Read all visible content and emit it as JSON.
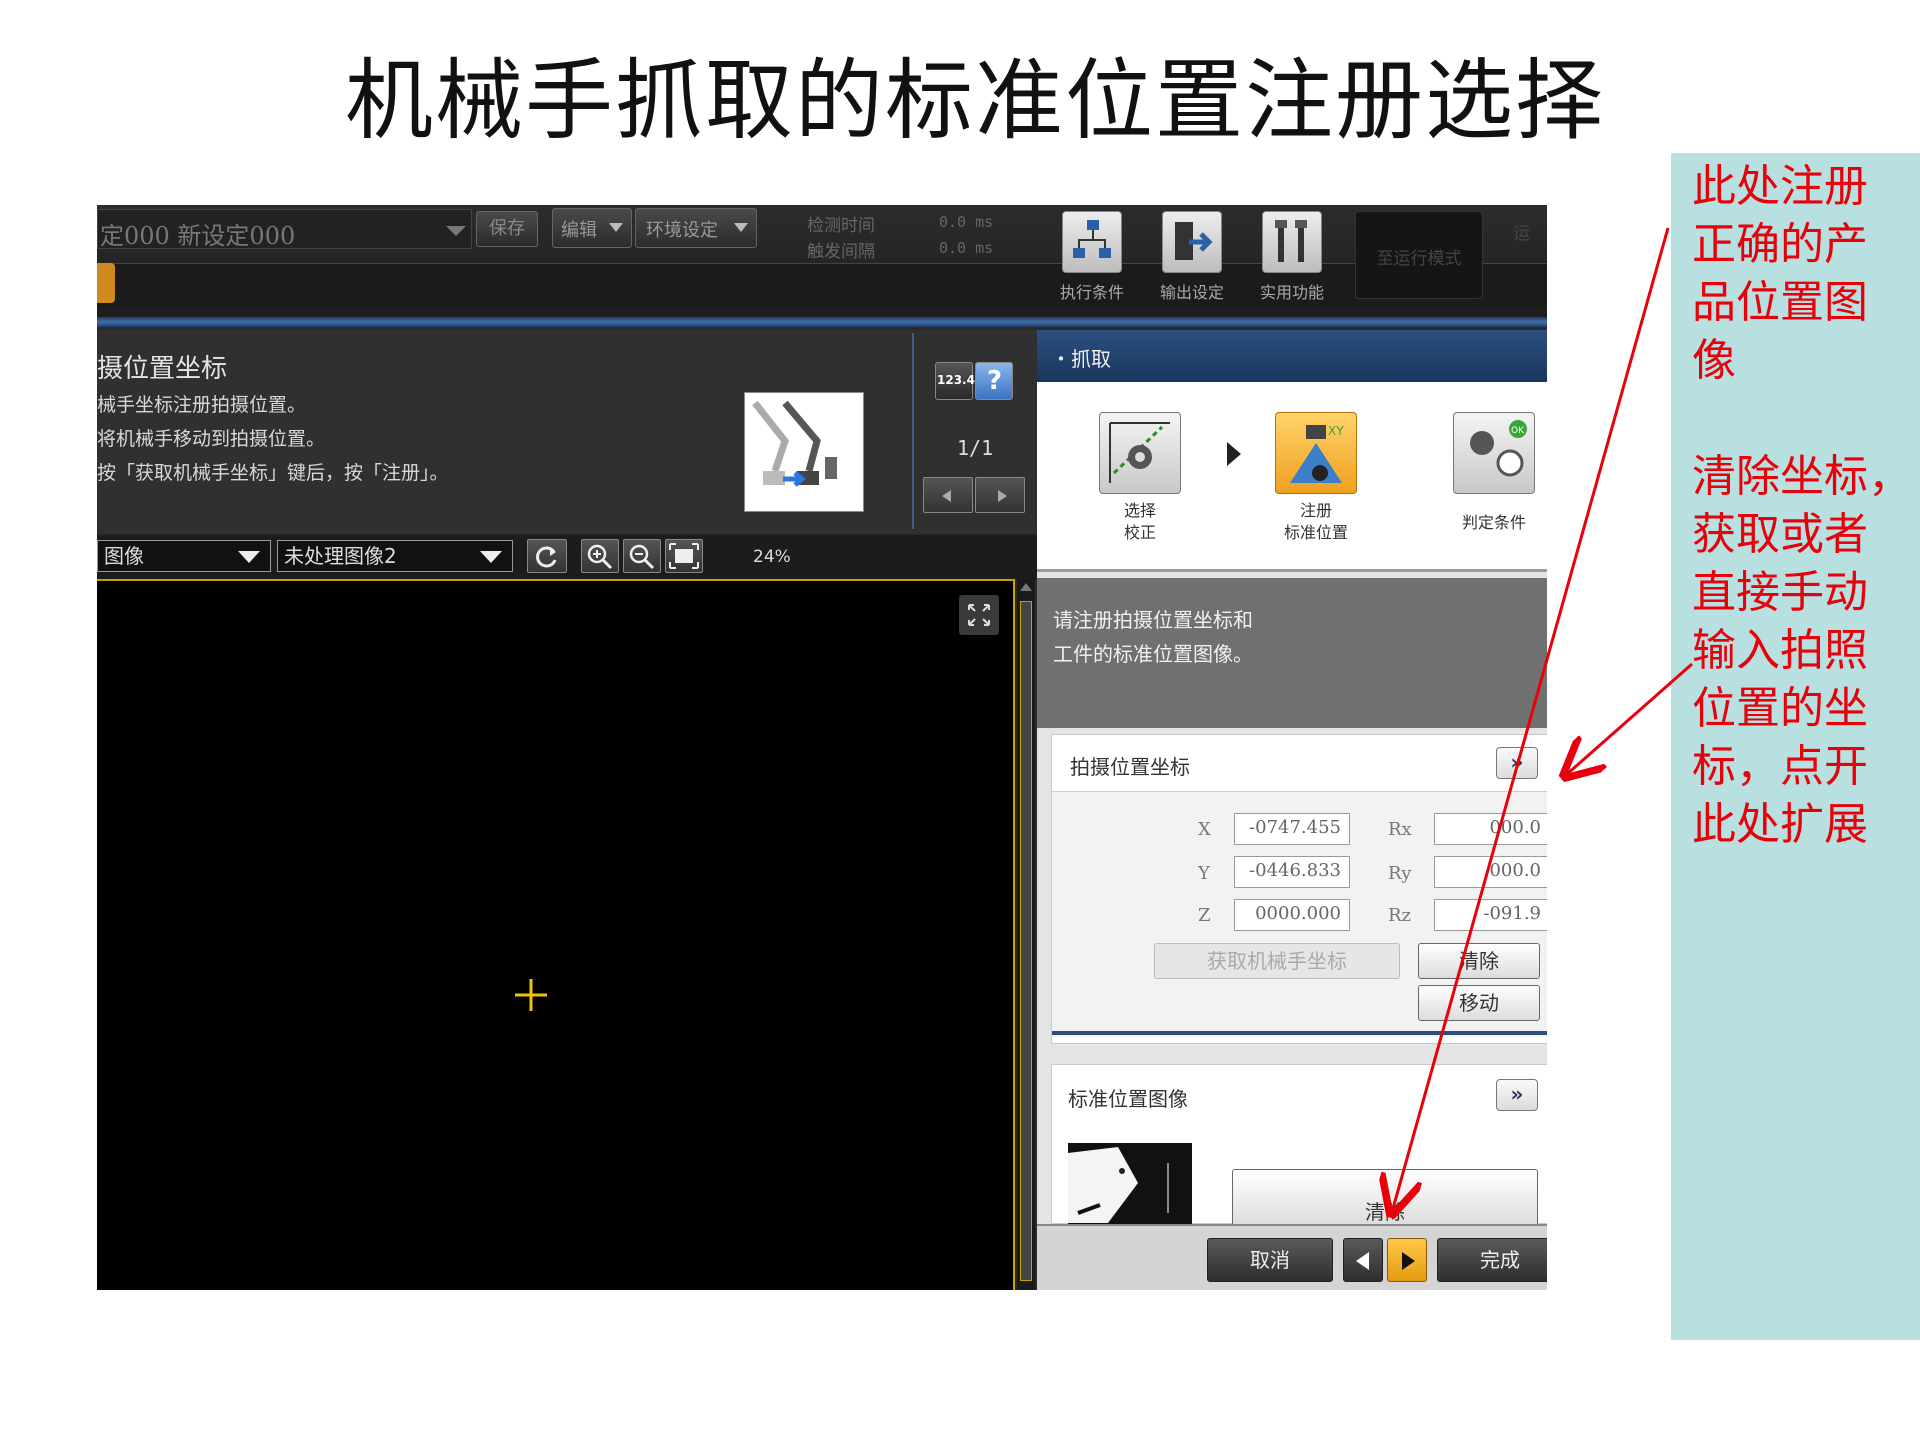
{
  "slide": {
    "title": "机械手抓取的标准位置注册选择",
    "annotation": "此处注册\n正确的产\n品位置图\n像\n\n清除坐标，\n获取或者\n直接手动\n输入拍照\n位置的坐\n标，点开\n此处扩展"
  },
  "toolbar": {
    "scene_label": "定000  新设定000",
    "save_label": "保存",
    "edit_menu": "编辑",
    "env_menu": "环境设定",
    "detect_time_label": "检测时间",
    "trigger_interval_label": "触发间隔",
    "detect_time_value": "0.0 ms",
    "trigger_interval_value": "0.0 ms",
    "exec_cond_label": "执行条件",
    "output_label": "输出设定",
    "utility_label": "实用功能",
    "run_mode_label": "至运行模式",
    "cut_label": "运"
  },
  "guide": {
    "title": "摄位置坐标",
    "line1": "械手坐标注册拍摄位置。",
    "line2": "将机械手移动到拍摄位置。",
    "line3": "按「获取机械手坐标」键后，按「注册」。",
    "num_btn": "123.4",
    "help_btn": "?",
    "page": "1/1"
  },
  "image_toolbar": {
    "image_select": "图像",
    "source_select": "未处理图像2",
    "zoom_level": "24%"
  },
  "right_panel": {
    "header": "・抓取",
    "steps": [
      {
        "label": "选择\n校正"
      },
      {
        "label": "注册\n标准位置"
      },
      {
        "label": "判定条件"
      }
    ],
    "instruction_line1": "请注册拍摄位置坐标和",
    "instruction_line2": "工件的标准位置图像。",
    "coord_section": {
      "title": "拍摄位置坐标",
      "expand": "»",
      "x_label": "X",
      "x_value": "-0747.455",
      "y_label": "Y",
      "y_value": "-0446.833",
      "z_label": "Z",
      "z_value": "0000.000",
      "rx_label": "Rx",
      "rx_value": "000.0",
      "ry_label": "Ry",
      "ry_value": "000.0",
      "rz_label": "Rz",
      "rz_value": "-091.9",
      "get_robot_btn": "获取机械手坐标",
      "clear_btn": "清除",
      "move_btn": "移动"
    },
    "image_section": {
      "title": "标准位置图像",
      "expand": "»",
      "clear_btn": "清除"
    },
    "footer": {
      "cancel": "取消",
      "finish": "完成"
    }
  },
  "colors": {
    "annotation_red": "#e8000b",
    "note_bg": "#b8e0e0",
    "accent_orange": "#f0a020",
    "crosshair": "#f2c400"
  }
}
